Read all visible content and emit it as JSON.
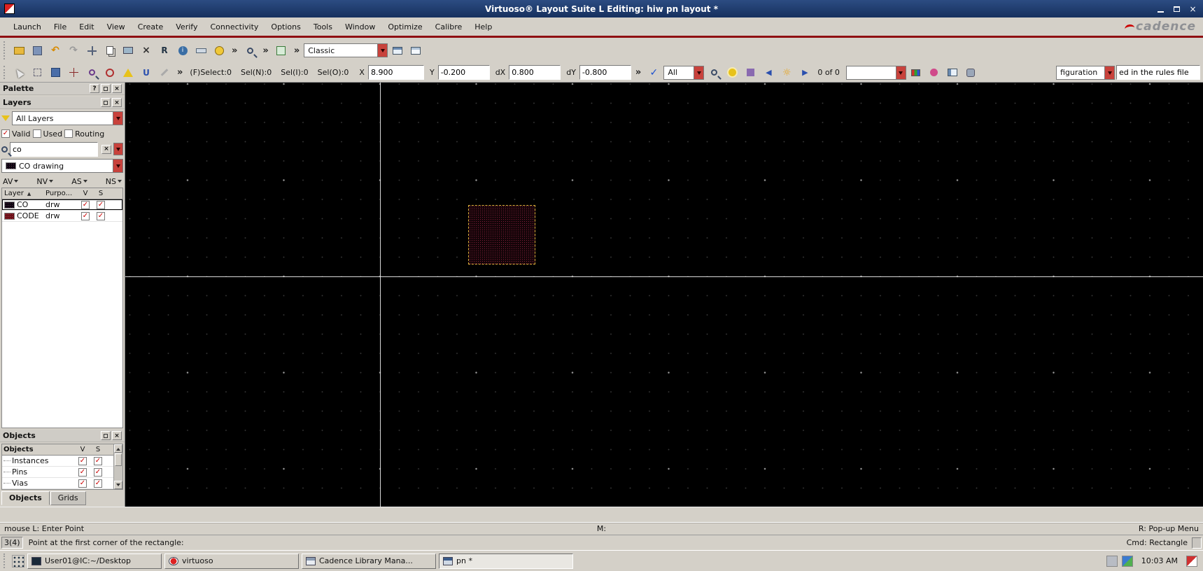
{
  "glyphs": {
    "overflow": "»",
    "check": "✓",
    "cross": "×",
    "sort": "▲",
    "left_arrow": "◀",
    "right_arrow": "▶",
    "sun": "☼",
    "undo": "↶",
    "redo": "↷",
    "info": "i",
    "r": "R",
    "u": "U",
    "help": "?",
    "x_letter": "X"
  },
  "window": {
    "title": "Virtuoso® Layout Suite L Editing: hiw pn layout *",
    "brand": "cadence"
  },
  "menubar": {
    "items": [
      "Launch",
      "File",
      "Edit",
      "View",
      "Create",
      "Verify",
      "Connectivity",
      "Options",
      "Tools",
      "Window",
      "Optimize",
      "Calibre",
      "Help"
    ]
  },
  "toolbar1": {
    "style_combo": "Classic"
  },
  "toolbar2": {
    "sel_status": [
      "(F)Select:0",
      "Sel(N):0",
      "Sel(I):0",
      "Sel(O):0"
    ],
    "x_label": "X",
    "x_value": "8.900",
    "y_label": "Y",
    "y_value": "-0.200",
    "dx_label": "dX",
    "dx_value": "0.800",
    "dy_label": "dY",
    "dy_value": "-0.800",
    "filter_combo": "All",
    "count": "0 of 0",
    "config_combo": "figuration",
    "rules_field": "ed in the rules file"
  },
  "palette": {
    "title": "Palette",
    "layers": {
      "title": "Layers",
      "scope_combo": "All Layers",
      "valid_label": "Valid",
      "used_label": "Used",
      "routing_label": "Routing",
      "search_value": "co",
      "active_layer": "CO drawing",
      "filters": [
        "AV",
        "NV",
        "AS",
        "NS"
      ],
      "headers": {
        "layer": "Layer",
        "purpose": "Purpo...",
        "v": "V",
        "s": "S"
      },
      "rows": [
        {
          "layer": "CO",
          "purpose": "drw"
        },
        {
          "layer": "CODE",
          "purpose": "drw"
        }
      ]
    },
    "objects": {
      "title": "Objects",
      "headers": {
        "name": "Objects",
        "v": "V",
        "s": "S"
      },
      "rows": [
        {
          "label": "Instances"
        },
        {
          "label": "Pins"
        },
        {
          "label": "Vias"
        }
      ],
      "tabs": [
        "Objects",
        "Grids"
      ]
    }
  },
  "statusbar": {
    "left": "mouse L: Enter Point",
    "center": "M:",
    "right": "R: Pop-up Menu"
  },
  "promptbar": {
    "counter": "3(4)",
    "message": "Point at the first corner of the rectangle:",
    "command": "Cmd: Rectangle"
  },
  "taskbar": {
    "buttons": [
      "User01@IC:~/Desktop",
      "virtuoso",
      "Cadence Library Mana...",
      "pn *"
    ],
    "clock": "10:03 AM"
  }
}
